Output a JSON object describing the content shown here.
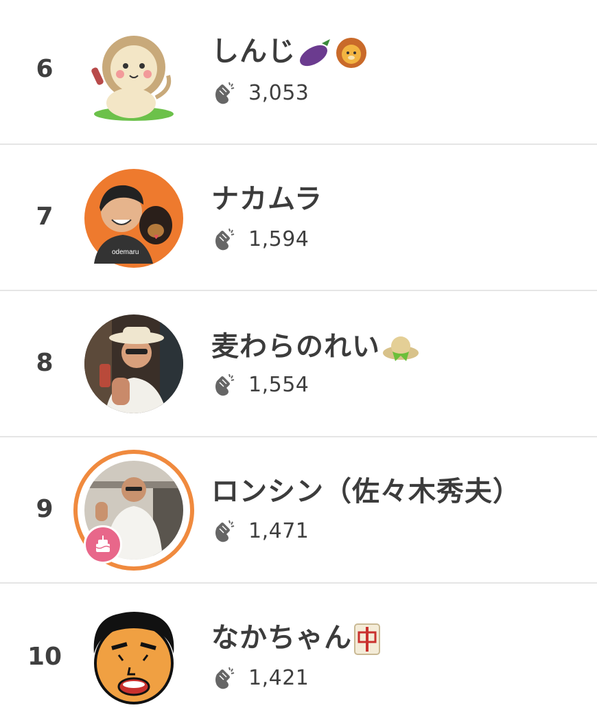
{
  "ranking": [
    {
      "rank": "6",
      "name": "しんじ",
      "name_emojis": [
        "eggplant-emoji",
        "lion-emoji"
      ],
      "claps": "3,053",
      "avatar": "lion-mascot-avatar"
    },
    {
      "rank": "7",
      "name": "ナカムラ",
      "name_emojis": [],
      "claps": "1,594",
      "avatar": "man-with-dog-avatar"
    },
    {
      "rank": "8",
      "name": "麦わらのれい",
      "name_emojis": [
        "straw-hat-emoji"
      ],
      "claps": "1,554",
      "avatar": "man-in-straw-hat-avatar"
    },
    {
      "rank": "9",
      "name": "ロンシン（佐々木秀夫）",
      "name_emojis": [],
      "claps": "1,471",
      "avatar": "man-in-white-sweater-avatar",
      "badge": "birthday-cake-icon"
    },
    {
      "rank": "10",
      "name": "なかちゃん",
      "name_emojis": [
        "mahjong-red-dragon-emoji"
      ],
      "claps": "1,421",
      "avatar": "cartoon-face-avatar"
    }
  ],
  "colors": {
    "accent_orange": "#f08a3e",
    "badge_pink": "#e8678a",
    "divider": "#e5e5e5",
    "text": "#3c3c3c"
  },
  "icons": {
    "clap": "clapping-hands-icon"
  }
}
